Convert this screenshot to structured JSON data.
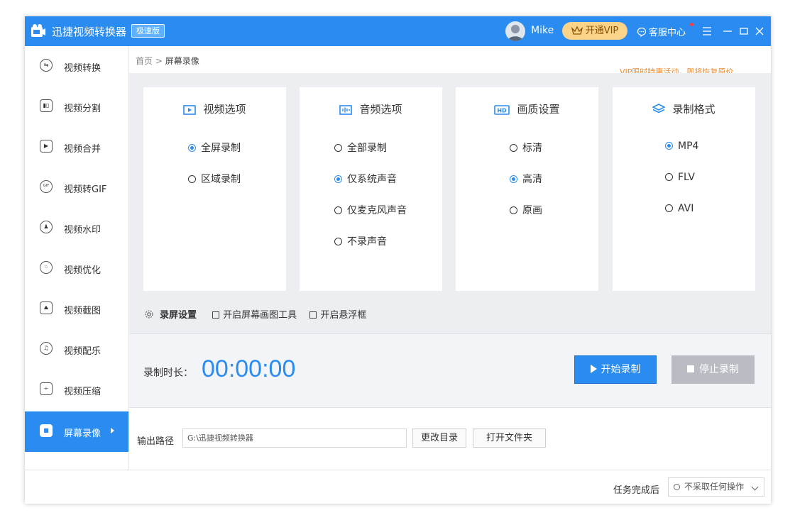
{
  "titlebar": {
    "app_name": "迅捷视频转换器",
    "edition_badge": "极速版",
    "username": "Mike",
    "vip_label": "开通VIP",
    "service_label": "客服中心",
    "accent": "#2a8cf0"
  },
  "sidebar": {
    "items": [
      {
        "label": "视频转换",
        "icon": "convert-icon"
      },
      {
        "label": "视频分割",
        "icon": "split-icon"
      },
      {
        "label": "视频合并",
        "icon": "merge-icon"
      },
      {
        "label": "视频转GIF",
        "icon": "gif-icon",
        "icon_text": "GIF"
      },
      {
        "label": "视频水印",
        "icon": "watermark-icon"
      },
      {
        "label": "视频优化",
        "icon": "optimize-icon"
      },
      {
        "label": "视频截图",
        "icon": "screenshot-icon"
      },
      {
        "label": "视频配乐",
        "icon": "music-icon"
      },
      {
        "label": "视频压缩",
        "icon": "compress-icon"
      },
      {
        "label": "屏幕录像",
        "icon": "record-icon",
        "active": true
      }
    ]
  },
  "breadcrumb": {
    "home": "首页",
    "separator": ">",
    "current": "屏幕录像"
  },
  "promo": "VIP限时特惠活动，即将恢复原价",
  "options": {
    "video": {
      "title": "视频选项",
      "items": [
        {
          "label": "全屏录制",
          "selected": true
        },
        {
          "label": "区域录制",
          "selected": false
        }
      ]
    },
    "audio": {
      "title": "音频选项",
      "items": [
        {
          "label": "全部录制",
          "selected": false
        },
        {
          "label": "仅系统声音",
          "selected": true
        },
        {
          "label": "仅麦克风声音",
          "selected": false
        },
        {
          "label": "不录声音",
          "selected": false
        }
      ]
    },
    "quality": {
      "title": "画质设置",
      "items": [
        {
          "label": "标清",
          "selected": false
        },
        {
          "label": "高清",
          "selected": true
        },
        {
          "label": "原画",
          "selected": false
        }
      ]
    },
    "format": {
      "title": "录制格式",
      "items": [
        {
          "label": "MP4",
          "selected": true
        },
        {
          "label": "FLV",
          "selected": false
        },
        {
          "label": "AVI",
          "selected": false
        }
      ]
    }
  },
  "rec_settings": {
    "title": "录屏设置",
    "draw_tool": "开启屏幕画图工具",
    "float_box": "开启悬浮框"
  },
  "timer": {
    "label": "录制时长：",
    "value": "00:00:00"
  },
  "buttons": {
    "start": "开始录制",
    "stop": "停止录制"
  },
  "output": {
    "label": "输出路径",
    "path": "G:\\迅捷视频转换器",
    "change_dir": "更改目录",
    "open_folder": "打开文件夹"
  },
  "footer": {
    "after_label": "任务完成后",
    "after_value": "不采取任何操作"
  }
}
